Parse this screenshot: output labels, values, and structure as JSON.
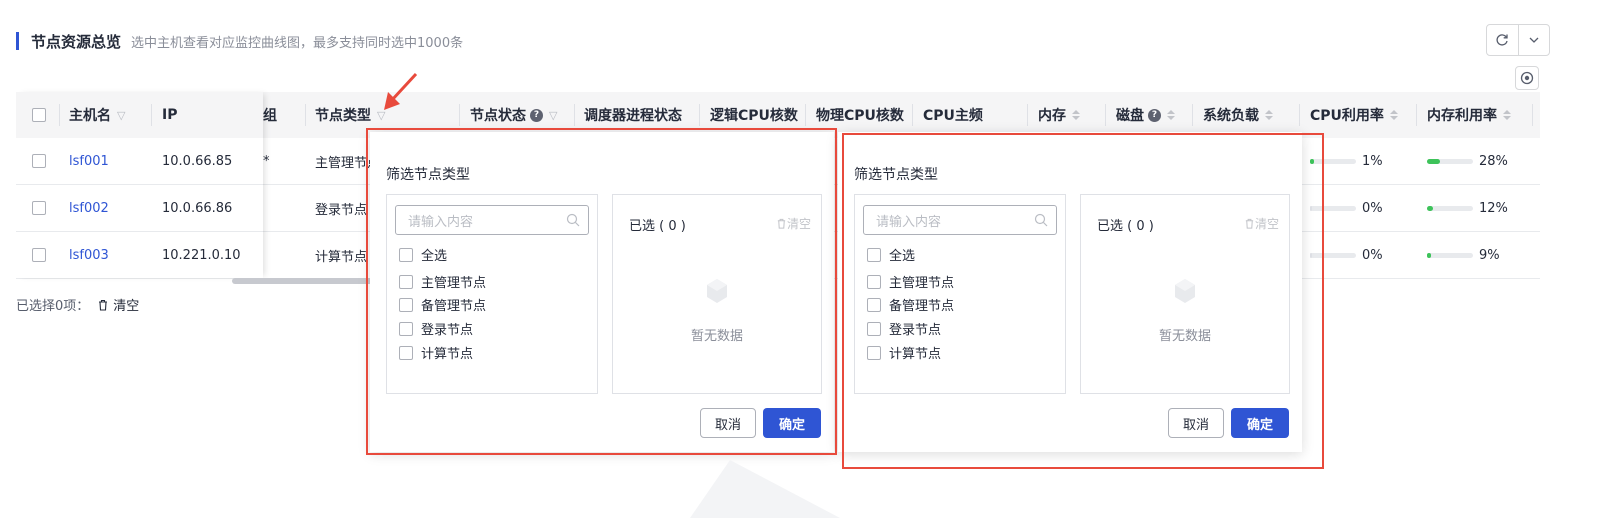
{
  "header": {
    "title": "节点资源总览",
    "subtitle": "选中主机查看对应监控曲线图，最多支持同时选中1000条"
  },
  "table": {
    "columns": {
      "hostname": "主机名",
      "ip": "IP",
      "group": "组",
      "node_type": "节点类型",
      "node_status": "节点状态",
      "scheduler": "调度器进程状态",
      "logical_cpu": "逻辑CPU核数",
      "physical_cpu": "物理CPU核数",
      "cpu_freq": "CPU主频",
      "memory": "内存",
      "disk": "磁盘",
      "load": "系统负载",
      "cpu_usage": "CPU利用率",
      "mem_usage": "内存利用率"
    },
    "rows": [
      {
        "hostname": "lsf001",
        "ip": "10.0.66.85",
        "group": "*",
        "node_type": "主管理节点",
        "cpu_usage": "1%",
        "cpu_ratio": 0.01,
        "mem_usage": "28%",
        "mem_ratio": 0.28
      },
      {
        "hostname": "lsf002",
        "ip": "10.0.66.86",
        "group": "",
        "node_type": "登录节点",
        "cpu_usage": "0%",
        "cpu_ratio": 0.0,
        "mem_usage": "12%",
        "mem_ratio": 0.12
      },
      {
        "hostname": "lsf003",
        "ip": "10.221.0.10",
        "group": "",
        "node_type": "计算节点",
        "cpu_usage": "0%",
        "cpu_ratio": 0.0,
        "mem_usage": "9%",
        "mem_ratio": 0.09
      }
    ]
  },
  "footer": {
    "selected": "已选择0项：",
    "clear": "清空"
  },
  "filter_panel": {
    "title": "筛选节点类型",
    "search_placeholder": "请输入内容",
    "select_all": "全选",
    "options": [
      "主管理节点",
      "备管理节点",
      "登录节点",
      "计算节点"
    ],
    "selected_header": "已选 ( 0 )",
    "clear": "清空",
    "empty": "暂无数据",
    "cancel": "取消",
    "ok": "确定"
  },
  "colors": {
    "accent": "#2f55d4",
    "highlight_frame": "#e84a3c",
    "usage_bar": "#3dc35a"
  }
}
